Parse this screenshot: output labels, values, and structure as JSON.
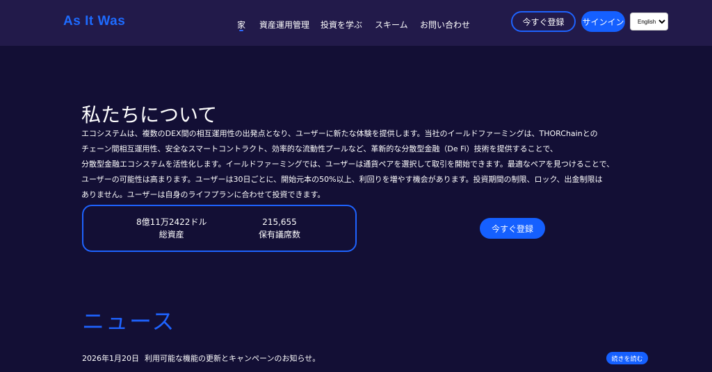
{
  "header": {
    "logo": "As It Was",
    "nav": [
      {
        "label": "家",
        "active": true
      },
      {
        "label": "資産運用管理",
        "active": false
      },
      {
        "label": "投資を学ぶ",
        "active": false
      },
      {
        "label": "スキーム",
        "active": false
      },
      {
        "label": "お問い合わせ",
        "active": false
      }
    ],
    "register_label": "今すぐ登録",
    "signin_label": "サインイン",
    "language": "English"
  },
  "about": {
    "title": "私たちについて",
    "lines": [
      "エコシステムは、複数のDEX間の相互運用性の出発点となり、ユーザーに新たな体験を提供します。当社のイールドファーミングは、THORChainとの",
      "チェーン間相互運用性、安全なスマートコントラクト、効率的な流動性プールなど、革新的な分散型金融（De Fi）技術を提供することで、",
      "分散型金融エコシステムを活性化します。イールドファーミングでは、ユーザーは通貨ペアを選択して取引を開始できます。最適なペアを見つけることで、",
      "ユーザーの可能性は高まります。ユーザーは30日ごとに、開始元本の50%以上、利回りを増やす機会があります。投資期間の制限、ロック、出金制限は",
      "ありません。ユーザーは自身のライフプランに合わせて投資できます。"
    ],
    "stats": [
      {
        "value": "8億11万2422ドル",
        "label": "総資産"
      },
      {
        "value": "215,655",
        "label": "保有議席数"
      }
    ],
    "register_label": "今すぐ登録"
  },
  "news": {
    "title": "ニュース",
    "items": [
      {
        "date": "2026年1月20日",
        "text": "利用可能な機能の更新とキャンペーンのお知らせ。",
        "button": "続きを読む"
      }
    ]
  },
  "colors": {
    "background": "#130f35",
    "header": "#221a4a",
    "accent": "#1560ff"
  }
}
